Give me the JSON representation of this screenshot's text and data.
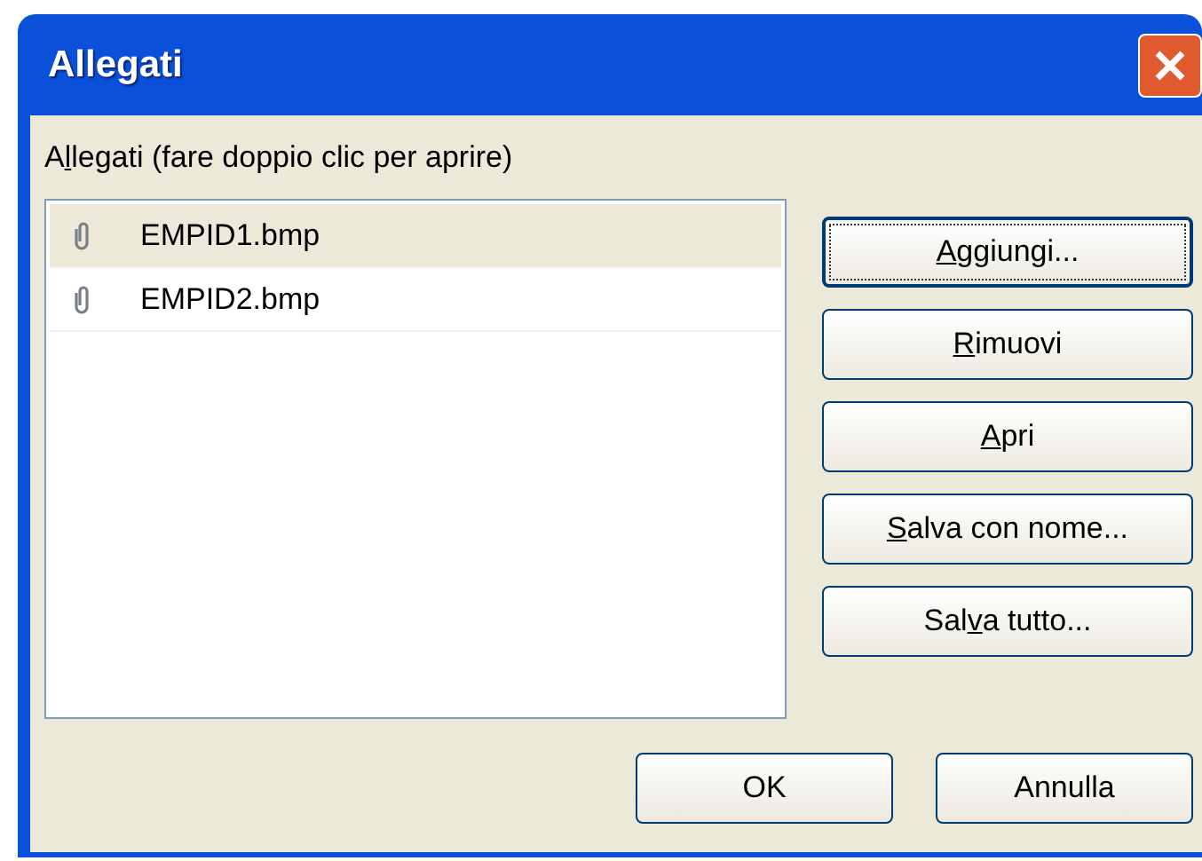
{
  "window": {
    "title": "Allegati"
  },
  "list_label": {
    "pre": "A",
    "key": "l",
    "post": "legati (fare doppio clic per aprire)"
  },
  "attachments": [
    {
      "name": "EMPID1.bmp",
      "selected": true
    },
    {
      "name": "EMPID2.bmp",
      "selected": false
    }
  ],
  "side_buttons": [
    {
      "key": "A",
      "post": "ggiungi...",
      "focused": true
    },
    {
      "key": "R",
      "post": "imuovi",
      "focused": false
    },
    {
      "key": "A",
      "post": "pri",
      "focused": false
    },
    {
      "key": "S",
      "post": "alva con nome...",
      "focused": false
    },
    {
      "pre": "Sal",
      "key": "v",
      "post": "a tutto...",
      "focused": false
    }
  ],
  "footer_buttons": [
    {
      "label": "OK"
    },
    {
      "label": "Annulla"
    }
  ]
}
